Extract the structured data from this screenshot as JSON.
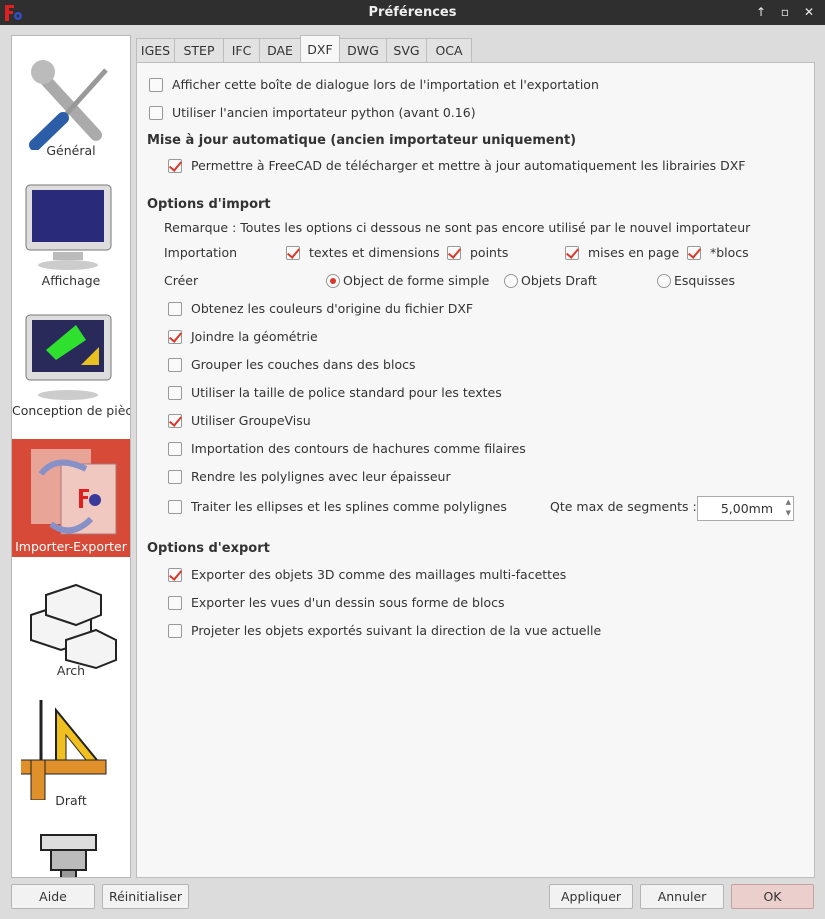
{
  "window": {
    "title": "Préférences",
    "icons": [
      "freecad-logo-icon",
      "maximize-icon",
      "restore-icon",
      "close-icon"
    ]
  },
  "sidebar": {
    "items": [
      {
        "label": "Général",
        "icon": "tools-icon"
      },
      {
        "label": "Affichage",
        "icon": "monitor-icon"
      },
      {
        "label": "Conception de pièces",
        "icon": "part-design-icon"
      },
      {
        "label": "Importer-Exporter",
        "icon": "import-export-icon",
        "selected": true
      },
      {
        "label": "Arch",
        "icon": "arch-blocks-icon"
      },
      {
        "label": "Draft",
        "icon": "draft-square-icon"
      },
      {
        "label": "",
        "icon": "path-mill-icon"
      }
    ]
  },
  "tabs": [
    {
      "label": "IGES"
    },
    {
      "label": "STEP"
    },
    {
      "label": "IFC"
    },
    {
      "label": "DAE"
    },
    {
      "label": "DXF",
      "active": true
    },
    {
      "label": "DWG"
    },
    {
      "label": "SVG"
    },
    {
      "label": "OCA"
    }
  ],
  "dxf": {
    "show_dialog": {
      "label": "Afficher cette boîte de dialogue lors de l'importation et l'exportation",
      "checked": false
    },
    "legacy_importer": {
      "label": "Utiliser l'ancien importateur python (avant 0.16)",
      "checked": false
    },
    "auto_update_heading": "Mise à jour automatique (ancien importateur uniquement)",
    "allow_download": {
      "label": "Permettre à FreeCAD de télécharger et mettre à jour automatiquement les librairies DXF",
      "checked": true
    },
    "import_heading": "Options d'import",
    "remark": "Remarque : Toutes les options ci dessous ne sont pas encore utilisé par le nouvel importateur",
    "importation_label": "Importation",
    "importation": [
      {
        "label": "textes et dimensions",
        "checked": true
      },
      {
        "label": "points",
        "checked": true
      },
      {
        "label": "mises en page",
        "checked": true
      },
      {
        "label": "*blocs",
        "checked": true
      }
    ],
    "create_label": "Créer",
    "create": [
      {
        "label": "Object de forme simple",
        "selected": true
      },
      {
        "label": "Objets Draft",
        "selected": false
      },
      {
        "label": "Esquisses",
        "selected": false
      }
    ],
    "import_options": [
      {
        "label": "Obtenez les couleurs d'origine du fichier DXF",
        "checked": false
      },
      {
        "label": "Joindre la géométrie",
        "checked": true
      },
      {
        "label": "Grouper les couches dans des blocs",
        "checked": false
      },
      {
        "label": "Utiliser la taille de police standard pour les textes",
        "checked": false
      },
      {
        "label": "Utiliser GroupeVisu",
        "checked": true
      },
      {
        "label": "Importation des contours de hachures comme filaires",
        "checked": false
      },
      {
        "label": "Rendre les polylignes avec leur épaisseur",
        "checked": false
      },
      {
        "label": "Traiter les ellipses et les splines comme polylignes",
        "checked": false
      }
    ],
    "max_segments_label": "Qte max de segments :",
    "max_segments_value": "5,00mm",
    "export_heading": "Options d'export",
    "export_options": [
      {
        "label": "Exporter des objets 3D comme des maillages multi-facettes",
        "checked": true
      },
      {
        "label": "Exporter les vues d'un dessin sous forme de blocs",
        "checked": false
      },
      {
        "label": "Projeter les objets exportés suivant la direction de la vue actuelle",
        "checked": false
      }
    ]
  },
  "buttons": {
    "help": "Aide",
    "reset": "Réinitialiser",
    "apply": "Appliquer",
    "cancel": "Annuler",
    "ok": "OK"
  },
  "colors": {
    "accent": "#d84a38",
    "check": "#d8392b",
    "titlebar": "#2f2f2f",
    "ok_button": "#ebcfcd"
  }
}
